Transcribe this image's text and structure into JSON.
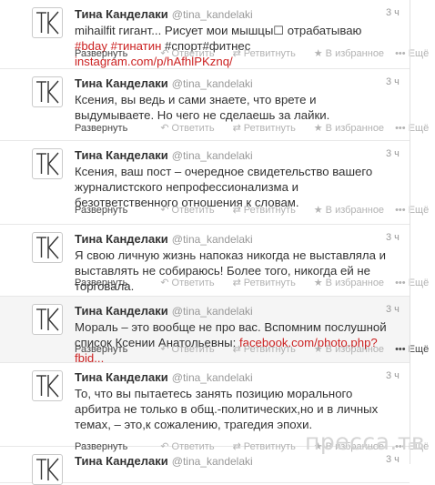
{
  "tweets": [
    {
      "name": "Тина Канделаки",
      "handle": "@tina_kandelaki",
      "time": "3 ч",
      "text_parts": [
        {
          "t": "mihailfit гигант... Рисует мои мышцы☐ отрабатываю ",
          "k": "plain"
        },
        {
          "t": "#bday",
          "k": "tag"
        },
        {
          "t": " ",
          "k": "plain"
        },
        {
          "t": "#тинатин",
          "k": "tag"
        },
        {
          "t": " #спорт#фитнес ",
          "k": "plain"
        },
        {
          "t": "instagram.com/p/hAfhlPKznq/",
          "k": "lnk"
        }
      ],
      "expand": "Развернуть",
      "reply": "Ответить",
      "retweet": "Ретвитнуть",
      "favorite": "В избранное",
      "more": "Ещё"
    },
    {
      "name": "Тина Канделаки",
      "handle": "@tina_kandelaki",
      "time": "3 ч",
      "text_parts": [
        {
          "t": "Ксения, вы ведь и сами знаете, что врете и выдумываете. Но чего не сделаешь за лайки.",
          "k": "plain"
        }
      ],
      "expand": "Развернуть",
      "reply": "Ответить",
      "retweet": "Ретвитнуть",
      "favorite": "В избранное",
      "more": "Ещё"
    },
    {
      "name": "Тина Канделаки",
      "handle": "@tina_kandelaki",
      "time": "3 ч",
      "text_parts": [
        {
          "t": "Ксения, ваш пост – очередное свидетельство вашего журналистского непрофессионализма и безответственного отношения к словам.",
          "k": "plain"
        }
      ],
      "expand": "Развернуть",
      "reply": "Ответить",
      "retweet": "Ретвитнуть",
      "favorite": "В избранное",
      "more": "Ещё"
    },
    {
      "name": "Тина Канделаки",
      "handle": "@tina_kandelaki",
      "time": "3 ч",
      "text_parts": [
        {
          "t": "Я свою личную жизнь напоказ никогда не выставляла и выставлять не собираюсь! Более того, никогда ей не торговала.",
          "k": "plain"
        }
      ],
      "expand": "Развернуть",
      "reply": "Ответить",
      "retweet": "Ретвитнуть",
      "favorite": "В избранное",
      "more": "Ещё"
    },
    {
      "name": "Тина Канделаки",
      "handle": "@tina_kandelaki",
      "time": "3 ч",
      "text_parts": [
        {
          "t": "Мораль – это вообще не про вас. Вспомним послушной список Ксении Анатольевны: ",
          "k": "plain"
        },
        {
          "t": "facebook.com/photo.php?fbid...",
          "k": "lnk"
        }
      ],
      "expand": "Развернуть",
      "reply": "Ответить",
      "retweet": "Ретвитнуть",
      "favorite": "В избранное",
      "more": "Ещё"
    },
    {
      "name": "Тина Канделаки",
      "handle": "@tina_kandelaki",
      "time": "3 ч",
      "text_parts": [
        {
          "t": "То, что вы пытаетесь занять позицию морального арбитра не только в общ.-политических,но и в личных темах, – это,к сожалению, трагедия эпохи.",
          "k": "plain"
        }
      ],
      "expand": "Развернуть",
      "reply": "Ответить",
      "retweet": "Ретвитнуть",
      "favorite": "В избранное",
      "more": "Ещё"
    },
    {
      "name": "Тина Канделаки",
      "handle": "@tina_kandelaki",
      "time": "3 ч",
      "text_parts": [],
      "expand": "",
      "reply": "",
      "retweet": "",
      "favorite": "",
      "more": ""
    }
  ],
  "icons": {
    "reply": "reply-arrow-icon",
    "retweet": "retweet-arrows-icon",
    "favorite": "star-icon",
    "more": "ellipsis-icon"
  },
  "colors": {
    "link": "#cc2222",
    "muted": "#b3b3b3",
    "highlight_bg": "#f5f5f5"
  },
  "watermark": "пресса.тв"
}
